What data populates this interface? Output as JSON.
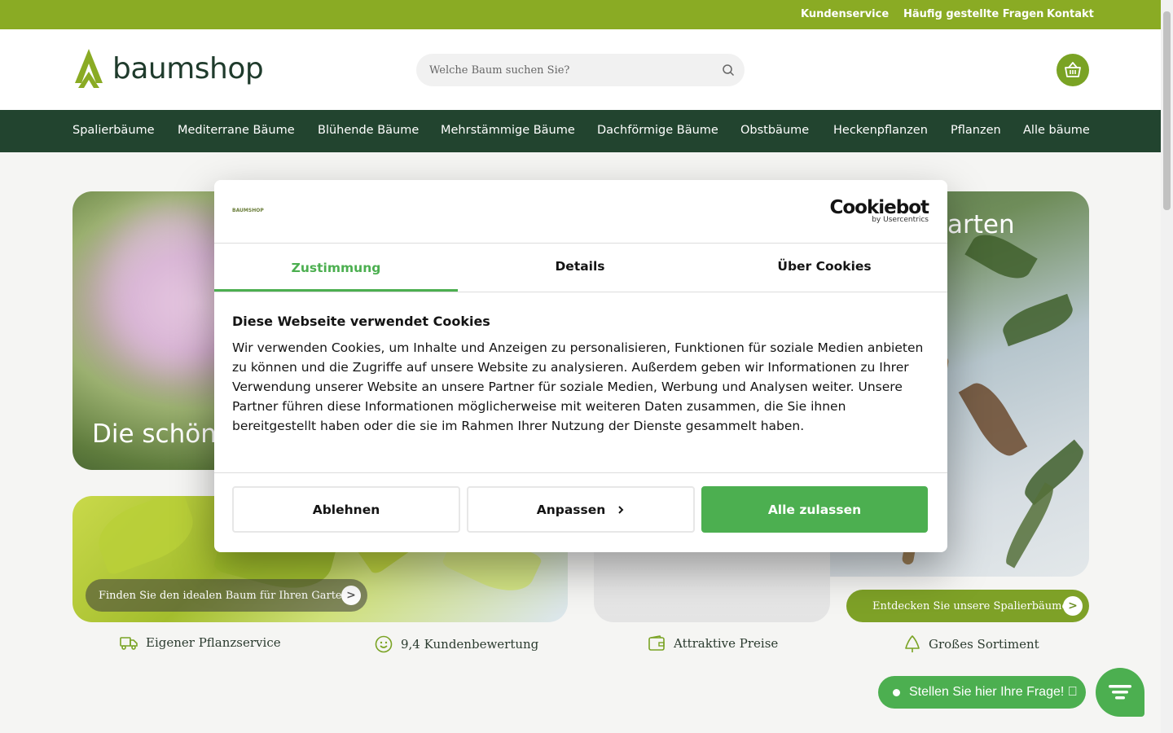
{
  "topbar": {
    "links": [
      "Kundenservice",
      "Häufig gestellte Fragen",
      "Kontakt"
    ]
  },
  "header": {
    "logo_text": "baumshop",
    "search_placeholder": "Welche Baum suchen Sie?"
  },
  "nav": {
    "items": [
      "Spalierbäume",
      "Mediterrane Bäume",
      "Blühende Bäume",
      "Mehrstämmige Bäume",
      "Dachförmige Bäume",
      "Obstbäume",
      "Heckenpflanzen",
      "Pflanzen",
      "Alle bäume"
    ]
  },
  "hero": {
    "left_title": "Die schön",
    "right_title": "arten",
    "tile_left_cta": "Finden Sie den idealen Baum für Ihren Garten",
    "tile_right_cta": "Entdecken Sie unsere Spalierbäume",
    "arrow": ">"
  },
  "usps": [
    "Eigener Pflanzservice",
    "9,4 Kundenbewertung",
    "Attraktive Preise",
    "Großes Sortiment"
  ],
  "cookie": {
    "brand_small": "BAUMSHOP",
    "cb_logo": "Cookiebot",
    "cb_sub": "by Usercentrics",
    "tabs": [
      "Zustimmung",
      "Details",
      "Über Cookies"
    ],
    "heading": "Diese Webseite verwendet Cookies",
    "body": "Wir verwenden Cookies, um Inhalte und Anzeigen zu personalisieren, Funktionen für soziale Medien anbieten zu können und die Zugriffe auf unsere Website zu analysieren. Außerdem geben wir Informationen zu Ihrer Verwendung unserer Website an unsere Partner für soziale Medien, Werbung und Analysen weiter. Unsere Partner führen diese Informationen möglicherweise mit weiteren Daten zusammen, die Sie ihnen bereitgestellt haben oder die sie im Rahmen Ihrer Nutzung der Dienste gesammelt haben.",
    "buttons": {
      "decline": "Ablehnen",
      "customize": "Anpassen",
      "accept": "Alle zulassen"
    }
  },
  "chat": {
    "label": "Stellen Sie hier Ihre Frage! 󰀀"
  },
  "colors": {
    "topbar": "#8aab24",
    "nav": "#22442f",
    "accent": "#4caf50",
    "brand_green": "#7aa324"
  },
  "icons": [
    "search-icon",
    "basket-icon",
    "truck-icon",
    "smiley-icon",
    "wallet-icon",
    "tree-icon",
    "chevron-right-icon",
    "chat-icon"
  ]
}
